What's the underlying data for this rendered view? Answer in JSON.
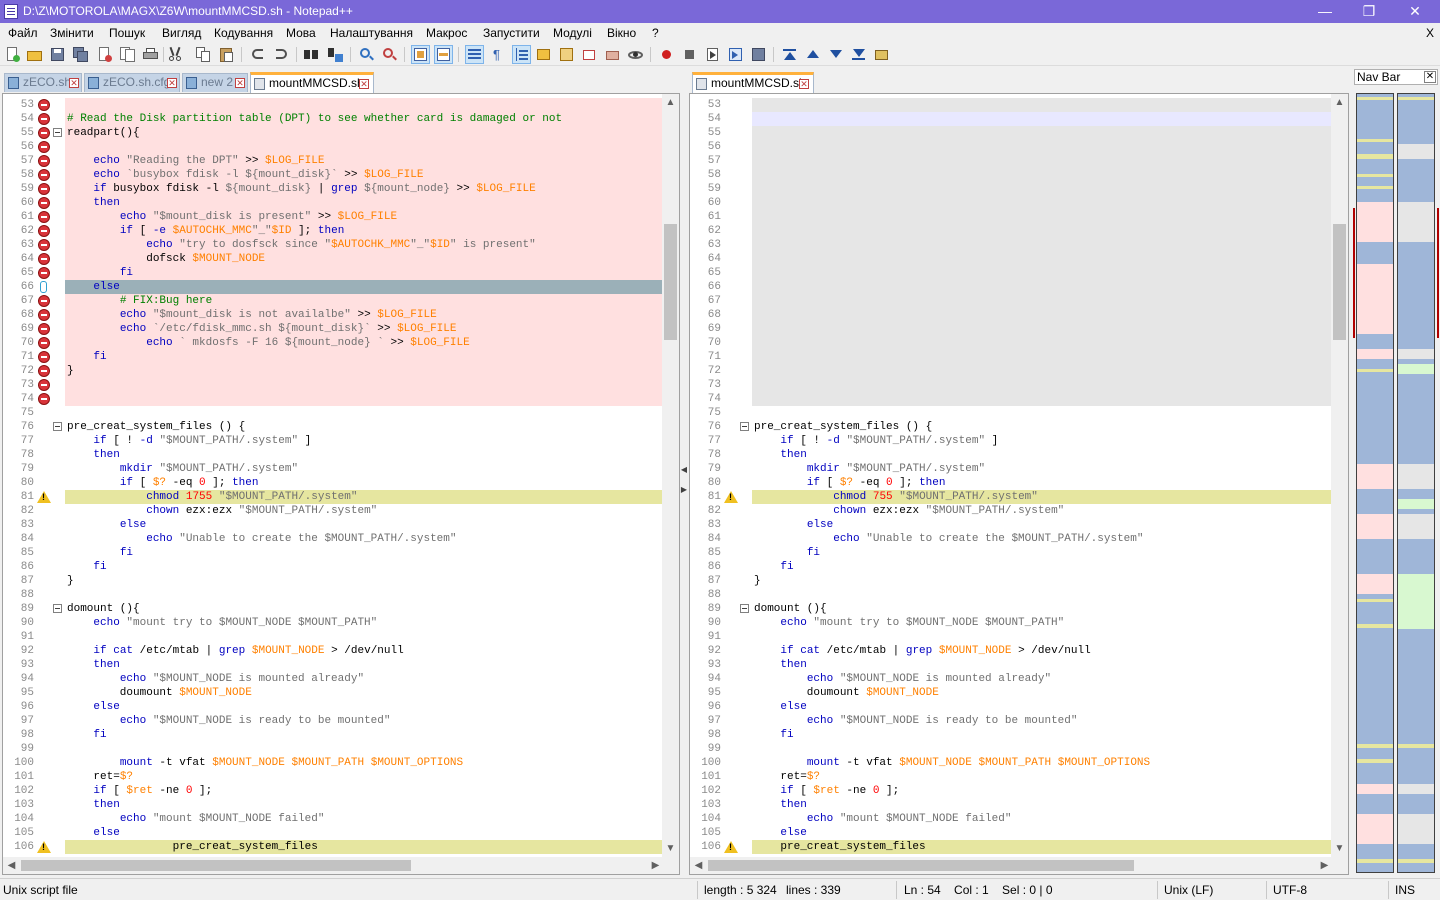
{
  "window": {
    "title": "D:\\Z\\MOTOROLA\\MAGX\\Z6W\\mountMMCSD.sh - Notepad++",
    "minimize": "—",
    "maximize": "❐",
    "close": "✕"
  },
  "menu": {
    "items": [
      "Файл",
      "Змінити",
      "Пошук",
      "Вигляд",
      "Кодування",
      "Мова",
      "Налаштування",
      "Макрос",
      "Запустити",
      "Модулі",
      "Вікно",
      "?"
    ],
    "close": "X"
  },
  "toolbar": {
    "icons": [
      "new-file",
      "open-file",
      "save",
      "save-all",
      "close",
      "close-all",
      "print",
      "cut",
      "copy",
      "paste",
      "undo",
      "redo",
      "find",
      "replace",
      "zoom-in",
      "zoom-out",
      "sync-vertical",
      "sync-horizontal",
      "word-wrap",
      "show-all-chars",
      "indent-guide",
      "user-language",
      "function-list",
      "folder-workspace",
      "document-map",
      "monitor",
      "record-macro",
      "stop-record",
      "play-macro",
      "run-macro-multiple",
      "save-macro",
      "compare-first",
      "compare-prev",
      "compare-next",
      "compare-last",
      "compare-clear"
    ]
  },
  "left_tabs": [
    {
      "label": "zECO.sh",
      "active": false
    },
    {
      "label": "zECO.sh.cfg",
      "active": false
    },
    {
      "label": "new 2",
      "active": false
    },
    {
      "label": "mountMMCSD.sh",
      "active": true
    }
  ],
  "right_tabs": [
    {
      "label": "mountMMCSD.sh",
      "active": true
    }
  ],
  "colors": {
    "deleted": "#ffe0e0",
    "blank": "#e6e6e6",
    "changed": "#e6e6a0",
    "selected": "#9bb0b8",
    "keyword": "#0000c0",
    "string": "#707070",
    "variable": "#ff8000",
    "comment": "#008000",
    "accent": "#ffb13c"
  },
  "left_lines": [
    {
      "n": "53",
      "bg": "deleted",
      "m": "del",
      "t": ""
    },
    {
      "n": "54",
      "bg": "deleted",
      "m": "del",
      "t": "<span class='com'># Read the Disk partition table (DPT) to see whether card is damaged or not</span>"
    },
    {
      "n": "55",
      "bg": "deleted",
      "m": "del",
      "f": "open",
      "t": "readpart(){"
    },
    {
      "n": "56",
      "bg": "deleted",
      "m": "del",
      "t": ""
    },
    {
      "n": "57",
      "bg": "deleted",
      "m": "del",
      "t": "    <span class='kw'>echo</span> <span class='str'>\"Reading the DPT\"</span> &gt;&gt; <span class='var'>$LOG_FILE</span>"
    },
    {
      "n": "58",
      "bg": "deleted",
      "m": "del",
      "t": "    <span class='kw'>echo</span> <span class='str'>`busybox fdisk -l ${mount_disk}`</span> &gt;&gt; <span class='var'>$LOG_FILE</span>"
    },
    {
      "n": "59",
      "bg": "deleted",
      "m": "del",
      "t": "    <span class='kw'>if</span> busybox fdisk -l <span class='str'>${mount_disk}</span> | <span class='kw'>grep</span> <span class='str'>${mount_node}</span> &gt;&gt; <span class='var'>$LOG_FILE</span>"
    },
    {
      "n": "60",
      "bg": "deleted",
      "m": "del",
      "t": "    <span class='kw'>then</span>"
    },
    {
      "n": "61",
      "bg": "deleted",
      "m": "del",
      "t": "        <span class='kw'>echo</span> <span class='str'>\"$mount_disk is present\"</span> &gt;&gt; <span class='var'>$LOG_FILE</span>"
    },
    {
      "n": "62",
      "bg": "deleted",
      "m": "del",
      "t": "        <span class='kw'>if</span> [ <span class='kw'>-e</span> <span class='var'>$AUTOCHK_MMC</span><span class='str'>\"_\"</span><span class='var'>$ID</span> ]; <span class='kw'>then</span>"
    },
    {
      "n": "63",
      "bg": "deleted",
      "m": "del",
      "t": "            <span class='kw'>echo</span> <span class='str'>\"try to dosfsck since \"</span><span class='var'>$AUTOCHK_MMC</span><span class='str'>\"_\"</span><span class='var'>$ID</span><span class='str'>\" is present\"</span>"
    },
    {
      "n": "64",
      "bg": "deleted",
      "m": "del",
      "t": "            dofsck <span class='var'>$MOUNT_NODE</span>"
    },
    {
      "n": "65",
      "bg": "deleted",
      "m": "del",
      "t": "        <span class='kw'>fi</span>"
    },
    {
      "n": "66",
      "bg": "selected",
      "m": "moved",
      "t": "    <span class='kw'>else</span>"
    },
    {
      "n": "67",
      "bg": "deleted",
      "m": "del",
      "t": "        <span class='com'># FIX:Bug here</span>"
    },
    {
      "n": "68",
      "bg": "deleted",
      "m": "del",
      "t": "        <span class='kw'>echo</span> <span class='str'>\"$mount_disk is not availalbe\"</span> &gt;&gt; <span class='var'>$LOG_FILE</span>"
    },
    {
      "n": "69",
      "bg": "deleted",
      "m": "del",
      "t": "        <span class='kw'>echo</span> <span class='str'>`/etc/fdisk_mmc.sh ${mount_disk}`</span> &gt;&gt; <span class='var'>$LOG_FILE</span>"
    },
    {
      "n": "70",
      "bg": "deleted",
      "m": "del",
      "t": "            <span class='kw'>echo</span> <span class='str'>` mkdosfs -F 16 ${mount_node} `</span> &gt;&gt; <span class='var'>$LOG_FILE</span>"
    },
    {
      "n": "71",
      "bg": "deleted",
      "m": "del",
      "t": "    <span class='kw'>fi</span>"
    },
    {
      "n": "72",
      "bg": "deleted",
      "m": "del",
      "t": "}"
    },
    {
      "n": "73",
      "bg": "deleted",
      "m": "del",
      "t": ""
    },
    {
      "n": "74",
      "bg": "deleted",
      "m": "del",
      "t": ""
    },
    {
      "n": "75",
      "t": ""
    },
    {
      "n": "76",
      "f": "open",
      "t": "pre_creat_system_files () {"
    },
    {
      "n": "77",
      "t": "    <span class='kw'>if</span> [ ! <span class='kw'>-d</span> <span class='str'>\"$MOUNT_PATH/.system\"</span> ]"
    },
    {
      "n": "78",
      "t": "    <span class='kw'>then</span>"
    },
    {
      "n": "79",
      "t": "        <span class='kw'>mkdir</span> <span class='str'>\"$MOUNT_PATH/.system\"</span>"
    },
    {
      "n": "80",
      "t": "        <span class='kw'>if</span> [ <span class='var'>$?</span> -eq <span class='num'>0</span> ]; <span class='kw'>then</span>"
    },
    {
      "n": "81",
      "bg": "changed",
      "m": "warn",
      "t": "            <span class='kw'>chmod</span> <span class='num'>1755</span> <span class='str'>\"$MOUNT_PATH/.system\"</span>"
    },
    {
      "n": "82",
      "t": "            <span class='kw'>chown</span> ezx:ezx <span class='str'>\"$MOUNT_PATH/.system\"</span>"
    },
    {
      "n": "83",
      "t": "        <span class='kw'>else</span>"
    },
    {
      "n": "84",
      "t": "            <span class='kw'>echo</span> <span class='str'>\"Unable to create the $MOUNT_PATH/.system\"</span>"
    },
    {
      "n": "85",
      "t": "        <span class='kw'>fi</span>"
    },
    {
      "n": "86",
      "t": "    <span class='kw'>fi</span>"
    },
    {
      "n": "87",
      "t": "}"
    },
    {
      "n": "88",
      "t": ""
    },
    {
      "n": "89",
      "f": "open",
      "t": "domount (){"
    },
    {
      "n": "90",
      "t": "    <span class='kw'>echo</span> <span class='str'>\"mount try to $MOUNT_NODE $MOUNT_PATH\"</span>"
    },
    {
      "n": "91",
      "t": ""
    },
    {
      "n": "92",
      "t": "    <span class='kw'>if</span> <span class='kw'>cat</span> /etc/mtab | <span class='kw'>grep</span> <span class='var'>$MOUNT_NODE</span> &gt; /dev/null"
    },
    {
      "n": "93",
      "t": "    <span class='kw'>then</span>"
    },
    {
      "n": "94",
      "t": "        <span class='kw'>echo</span> <span class='str'>\"$MOUNT_NODE is mounted already\"</span>"
    },
    {
      "n": "95",
      "t": "        doumount <span class='var'>$MOUNT_NODE</span>"
    },
    {
      "n": "96",
      "t": "    <span class='kw'>else</span>"
    },
    {
      "n": "97",
      "t": "        <span class='kw'>echo</span> <span class='str'>\"$MOUNT_NODE is ready to be mounted\"</span>"
    },
    {
      "n": "98",
      "t": "    <span class='kw'>fi</span>"
    },
    {
      "n": "99",
      "t": ""
    },
    {
      "n": "100",
      "t": "        <span class='kw'>mount</span> -t vfat <span class='var'>$MOUNT_NODE</span> <span class='var'>$MOUNT_PATH</span> <span class='var'>$MOUNT_OPTIONS</span>"
    },
    {
      "n": "101",
      "t": "    ret=<span class='var'>$?</span>"
    },
    {
      "n": "102",
      "t": "    <span class='kw'>if</span> [ <span class='var'>$ret</span> -ne <span class='num'>0</span> ];"
    },
    {
      "n": "103",
      "t": "    <span class='kw'>then</span>"
    },
    {
      "n": "104",
      "t": "        <span class='kw'>echo</span> <span class='str'>\"mount $MOUNT_NODE failed\"</span>"
    },
    {
      "n": "105",
      "t": "    <span class='kw'>else</span>"
    },
    {
      "n": "106",
      "bg": "changed",
      "m": "warn",
      "t": "                pre_creat_system_files"
    }
  ],
  "right_lines": [
    {
      "n": "53",
      "bg": "blank",
      "t": ""
    },
    {
      "n": "54",
      "bg": "current",
      "t": ""
    },
    {
      "n": "55",
      "bg": "blank",
      "t": ""
    },
    {
      "n": "56",
      "bg": "blank",
      "t": ""
    },
    {
      "n": "57",
      "bg": "blank",
      "t": ""
    },
    {
      "n": "58",
      "bg": "blank",
      "t": ""
    },
    {
      "n": "59",
      "bg": "blank",
      "t": ""
    },
    {
      "n": "60",
      "bg": "blank",
      "t": ""
    },
    {
      "n": "61",
      "bg": "blank",
      "t": ""
    },
    {
      "n": "62",
      "bg": "blank",
      "t": ""
    },
    {
      "n": "63",
      "bg": "blank",
      "t": ""
    },
    {
      "n": "64",
      "bg": "blank",
      "t": ""
    },
    {
      "n": "65",
      "bg": "blank",
      "t": ""
    },
    {
      "n": "66",
      "bg": "blank",
      "t": ""
    },
    {
      "n": "67",
      "bg": "blank",
      "t": ""
    },
    {
      "n": "68",
      "bg": "blank",
      "t": ""
    },
    {
      "n": "69",
      "bg": "blank",
      "t": ""
    },
    {
      "n": "70",
      "bg": "blank",
      "t": ""
    },
    {
      "n": "71",
      "bg": "blank",
      "t": ""
    },
    {
      "n": "72",
      "bg": "blank",
      "t": ""
    },
    {
      "n": "73",
      "bg": "blank",
      "t": ""
    },
    {
      "n": "74",
      "bg": "blank",
      "t": ""
    },
    {
      "n": "75",
      "t": ""
    },
    {
      "n": "76",
      "f": "open",
      "t": "pre_creat_system_files () {"
    },
    {
      "n": "77",
      "t": "    <span class='kw'>if</span> [ ! <span class='kw'>-d</span> <span class='str'>\"$MOUNT_PATH/.system\"</span> ]"
    },
    {
      "n": "78",
      "t": "    <span class='kw'>then</span>"
    },
    {
      "n": "79",
      "t": "        <span class='kw'>mkdir</span> <span class='str'>\"$MOUNT_PATH/.system\"</span>"
    },
    {
      "n": "80",
      "t": "        <span class='kw'>if</span> [ <span class='var'>$?</span> -eq <span class='num'>0</span> ]; <span class='kw'>then</span>"
    },
    {
      "n": "81",
      "bg": "changed",
      "m": "warn",
      "t": "            <span class='kw'>chmod</span> <span class='num'>755</span> <span class='str'>\"$MOUNT_PATH/.system\"</span>"
    },
    {
      "n": "82",
      "t": "            <span class='kw'>chown</span> ezx:ezx <span class='str'>\"$MOUNT_PATH/.system\"</span>"
    },
    {
      "n": "83",
      "t": "        <span class='kw'>else</span>"
    },
    {
      "n": "84",
      "t": "            <span class='kw'>echo</span> <span class='str'>\"Unable to create the $MOUNT_PATH/.system\"</span>"
    },
    {
      "n": "85",
      "t": "        <span class='kw'>fi</span>"
    },
    {
      "n": "86",
      "t": "    <span class='kw'>fi</span>"
    },
    {
      "n": "87",
      "t": "}"
    },
    {
      "n": "88",
      "t": ""
    },
    {
      "n": "89",
      "f": "open",
      "t": "domount (){"
    },
    {
      "n": "90",
      "t": "    <span class='kw'>echo</span> <span class='str'>\"mount try to $MOUNT_NODE $MOUNT_PATH\"</span>"
    },
    {
      "n": "91",
      "t": ""
    },
    {
      "n": "92",
      "t": "    <span class='kw'>if</span> <span class='kw'>cat</span> /etc/mtab | <span class='kw'>grep</span> <span class='var'>$MOUNT_NODE</span> &gt; /dev/null"
    },
    {
      "n": "93",
      "t": "    <span class='kw'>then</span>"
    },
    {
      "n": "94",
      "t": "        <span class='kw'>echo</span> <span class='str'>\"$MOUNT_NODE is mounted already\"</span>"
    },
    {
      "n": "95",
      "t": "        doumount <span class='var'>$MOUNT_NODE</span>"
    },
    {
      "n": "96",
      "t": "    <span class='kw'>else</span>"
    },
    {
      "n": "97",
      "t": "        <span class='kw'>echo</span> <span class='str'>\"$MOUNT_NODE is ready to be mounted\"</span>"
    },
    {
      "n": "98",
      "t": "    <span class='kw'>fi</span>"
    },
    {
      "n": "99",
      "t": ""
    },
    {
      "n": "100",
      "t": "        <span class='kw'>mount</span> -t vfat <span class='var'>$MOUNT_NODE</span> <span class='var'>$MOUNT_PATH</span> <span class='var'>$MOUNT_OPTIONS</span>"
    },
    {
      "n": "101",
      "t": "    ret=<span class='var'>$?</span>"
    },
    {
      "n": "102",
      "t": "    <span class='kw'>if</span> [ <span class='var'>$ret</span> -ne <span class='num'>0</span> ];"
    },
    {
      "n": "103",
      "t": "    <span class='kw'>then</span>"
    },
    {
      "n": "104",
      "t": "        <span class='kw'>echo</span> <span class='str'>\"mount $MOUNT_NODE failed\"</span>"
    },
    {
      "n": "105",
      "t": "    <span class='kw'>else</span>"
    },
    {
      "n": "106",
      "bg": "changed",
      "m": "warn",
      "t": "    pre_creat_system_files"
    }
  ],
  "nav_bar": {
    "title": "Nav Bar",
    "close": "✕"
  },
  "status": {
    "file_type": "Unix script file",
    "length": "length : 5 324",
    "lines": "lines : 339",
    "position": "Ln : 54    Col : 1    Sel : 0 | 0",
    "eol": "Unix (LF)",
    "encoding": "UTF-8",
    "mode": "INS"
  }
}
